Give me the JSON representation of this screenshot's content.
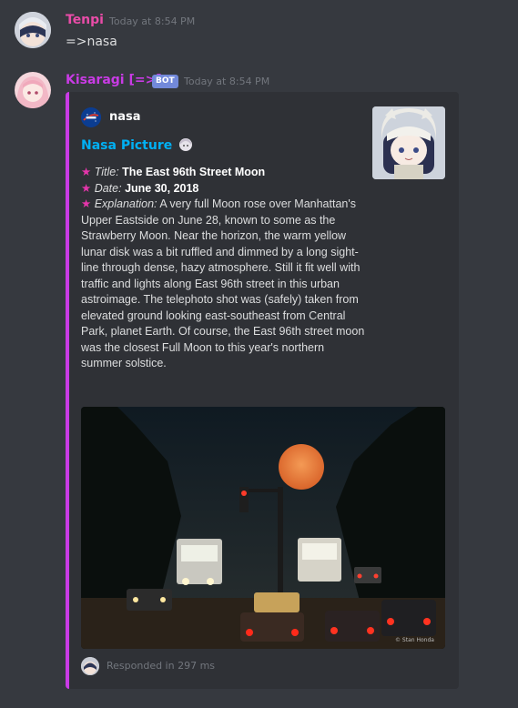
{
  "messages": [
    {
      "username": "Tenpi",
      "username_color": "#e94ca8",
      "timestamp": "Today at 8:54 PM",
      "content": "=>nasa"
    },
    {
      "username": "Kisaragi [=>]",
      "username_color": "#c93be5",
      "bot_tag": "BOT",
      "timestamp": "Today at 8:54 PM",
      "embed": {
        "accent_color": "#c93be5",
        "author": "nasa",
        "title": "Nasa Picture",
        "fields": {
          "title_label": "Title:",
          "title_value": "The East 96th Street Moon",
          "date_label": "Date:",
          "date_value": "June 30, 2018",
          "explanation_label": "Explanation:",
          "explanation_value": "A very full Moon rose over Manhattan's Upper Eastside on June 28, known to some as the Strawberry Moon. Near the horizon, the warm yellow lunar disk was a bit ruffled and dimmed by a long sight-line through dense, hazy atmosphere. Still it fit well with traffic and lights along East 96th street in this urban astroimage. The telephoto shot was (safely) taken from elevated ground looking east-southeast from Central Park, planet Earth. Of course, the East 96th street moon was the closest Full Moon to this year's northern summer solstice."
        },
        "star_glyph": "★",
        "image_watermark": "© Stan Honda",
        "footer": "Responded in 297 ms"
      }
    }
  ],
  "icons": {
    "title_emoji": "anime-girl-emoji",
    "star": "star-icon"
  }
}
